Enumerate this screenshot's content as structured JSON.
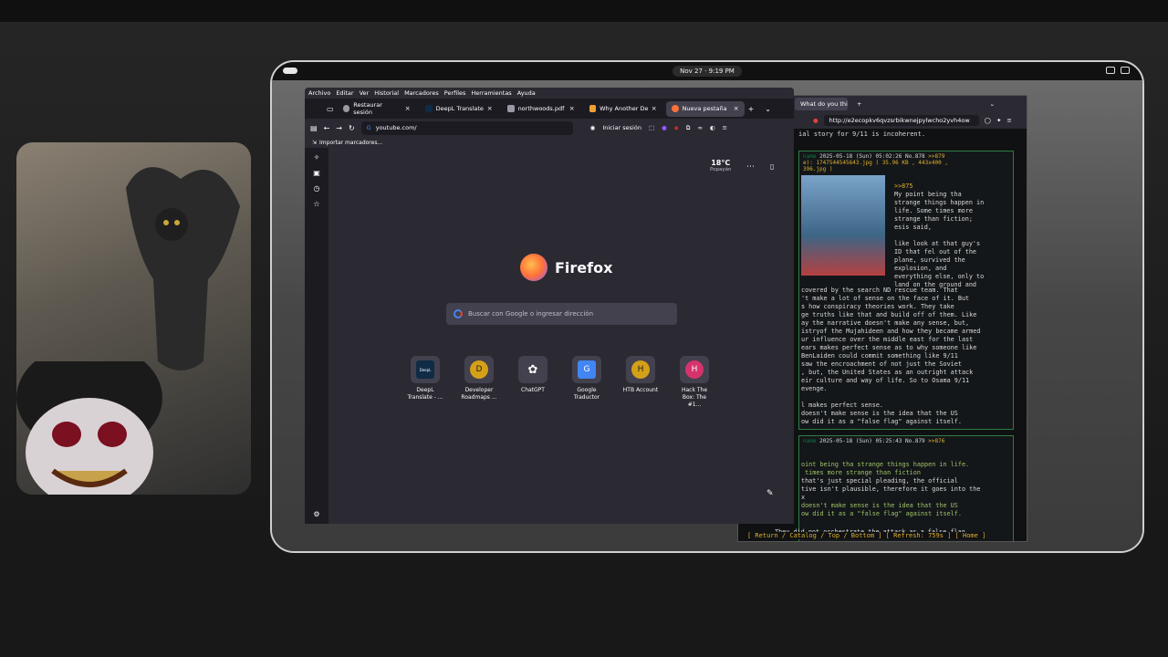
{
  "system": {
    "clock": "Nov 27 · 9:19 PM"
  },
  "firefox": {
    "menu": [
      "Archivo",
      "Editar",
      "Ver",
      "Historial",
      "Marcadores",
      "Perfiles",
      "Herramientas",
      "Ayuda"
    ],
    "tabs": [
      {
        "label": "Restaurar sesión",
        "icon": "restore-icon",
        "color": "#9a9aa5"
      },
      {
        "label": "DeepL Translate - E",
        "icon": "deepl-icon",
        "color": "#0f2b46"
      },
      {
        "label": "northwoods.pdf",
        "icon": "pdf-icon",
        "color": "#9a9aa5"
      },
      {
        "label": "Why Another Defe",
        "icon": "bookmark-icon",
        "color": "#f0a030"
      },
      {
        "label": "Nueva pestaña",
        "icon": "firefox-icon",
        "color": "#ff7139",
        "active": true
      }
    ],
    "url": "youtube.com/",
    "signin": "Iniciar sesión",
    "bookmarks_import": "Importar marcadores...",
    "weather": {
      "temp": "18°C",
      "city": "Popayán"
    },
    "brand": "Firefox",
    "search_placeholder": "Buscar con Google o ingresar dirección",
    "shortcuts": [
      {
        "label": "DeepL Translate - ...",
        "icon": "deepl-icon",
        "letter": "DeepL",
        "bg": "#0f2b46",
        "fg": "#ffffff"
      },
      {
        "label": "Developer Roadmaps ...",
        "icon": "letter-d-icon",
        "letter": "D",
        "bg": "#d4a017",
        "fg": "#1c1b22"
      },
      {
        "label": "ChatGPT",
        "icon": "chatgpt-icon",
        "letter": "✿",
        "bg": "#42414d",
        "fg": "#ffffff"
      },
      {
        "label": "Google Traductor",
        "icon": "google-translate-icon",
        "letter": "G",
        "bg": "#4285f4",
        "fg": "#ffffff"
      },
      {
        "label": "HTB Account",
        "icon": "letter-h-icon",
        "letter": "H",
        "bg": "#d4a017",
        "fg": "#1c1b22"
      },
      {
        "label": "Hack The Box: The #1...",
        "icon": "letter-h-pink-icon",
        "letter": "H",
        "bg": "#d6336c",
        "fg": "#ffffff"
      }
    ]
  },
  "tor": {
    "tab": "What do you thin",
    "url": "http://e2ecopkv6qvzsrbikwnejpylwcho2yvh4ow",
    "intro_line": "ial story for 9/11 is incoherent.",
    "post1": {
      "name": "name",
      "date": "2025-05-18 (Sun) 05:02:26 No.878",
      "replies": ">>879",
      "file_line": "e): 1747544545643.jpg ( 35.96 KB , 443x400 ,",
      "file_line2": "396.jpg )",
      "reply_to": ">>875",
      "body": "My point being tha\nstrange things happen in\nlife. Some times more\nstrange than fiction;\nesis said,\n\nlike look at that guy's\nID that fel out of the\nplane, survived the\nexplosion, and\neverything else, only to\nland on the ground and",
      "body2": "covered by the search ND rescue team. That\n't make a lot of sense on the face of it. But\ns how conspiracy theories work. They take\nge truths like that and build off of them. Like\nay the narrative doesn't make any sense, but,\nistryof the Mujahideen and how they became armed\nur influence over the middle east for the last\nears makes perfect sense as to why someone like\nBenLaiden could commit something like 9/11\nsaw the encroachment of not just the Soviet\n, but, the United States as an outright attack\neir culture and way of life. So to Osama 9/11\nevenge.\n\nl makes perfect sense.\ndoesn't make sense is the idea that the US\now did it as a \"false flag\" against itself."
    },
    "post2": {
      "name": "name",
      "date": "2025-05-18 (Sun) 05:25:43 No.879",
      "replies": ">>876",
      "green1": "oint being tha strange things happen in life.\n times more strange than fiction",
      "plain": "that's just special pleading, the official\ntive isn't plausible, therefore it goes into the\nx",
      "green2": "doesn't make sense is the idea that the US\now did it as a \"false flag\" against itself.",
      "last": "They did not orchestrate the attack as a false flag."
    },
    "footer": "[ Return / Catalog / Top / Bottom ] [ Refresh: 759s ]    [ Home ]"
  }
}
